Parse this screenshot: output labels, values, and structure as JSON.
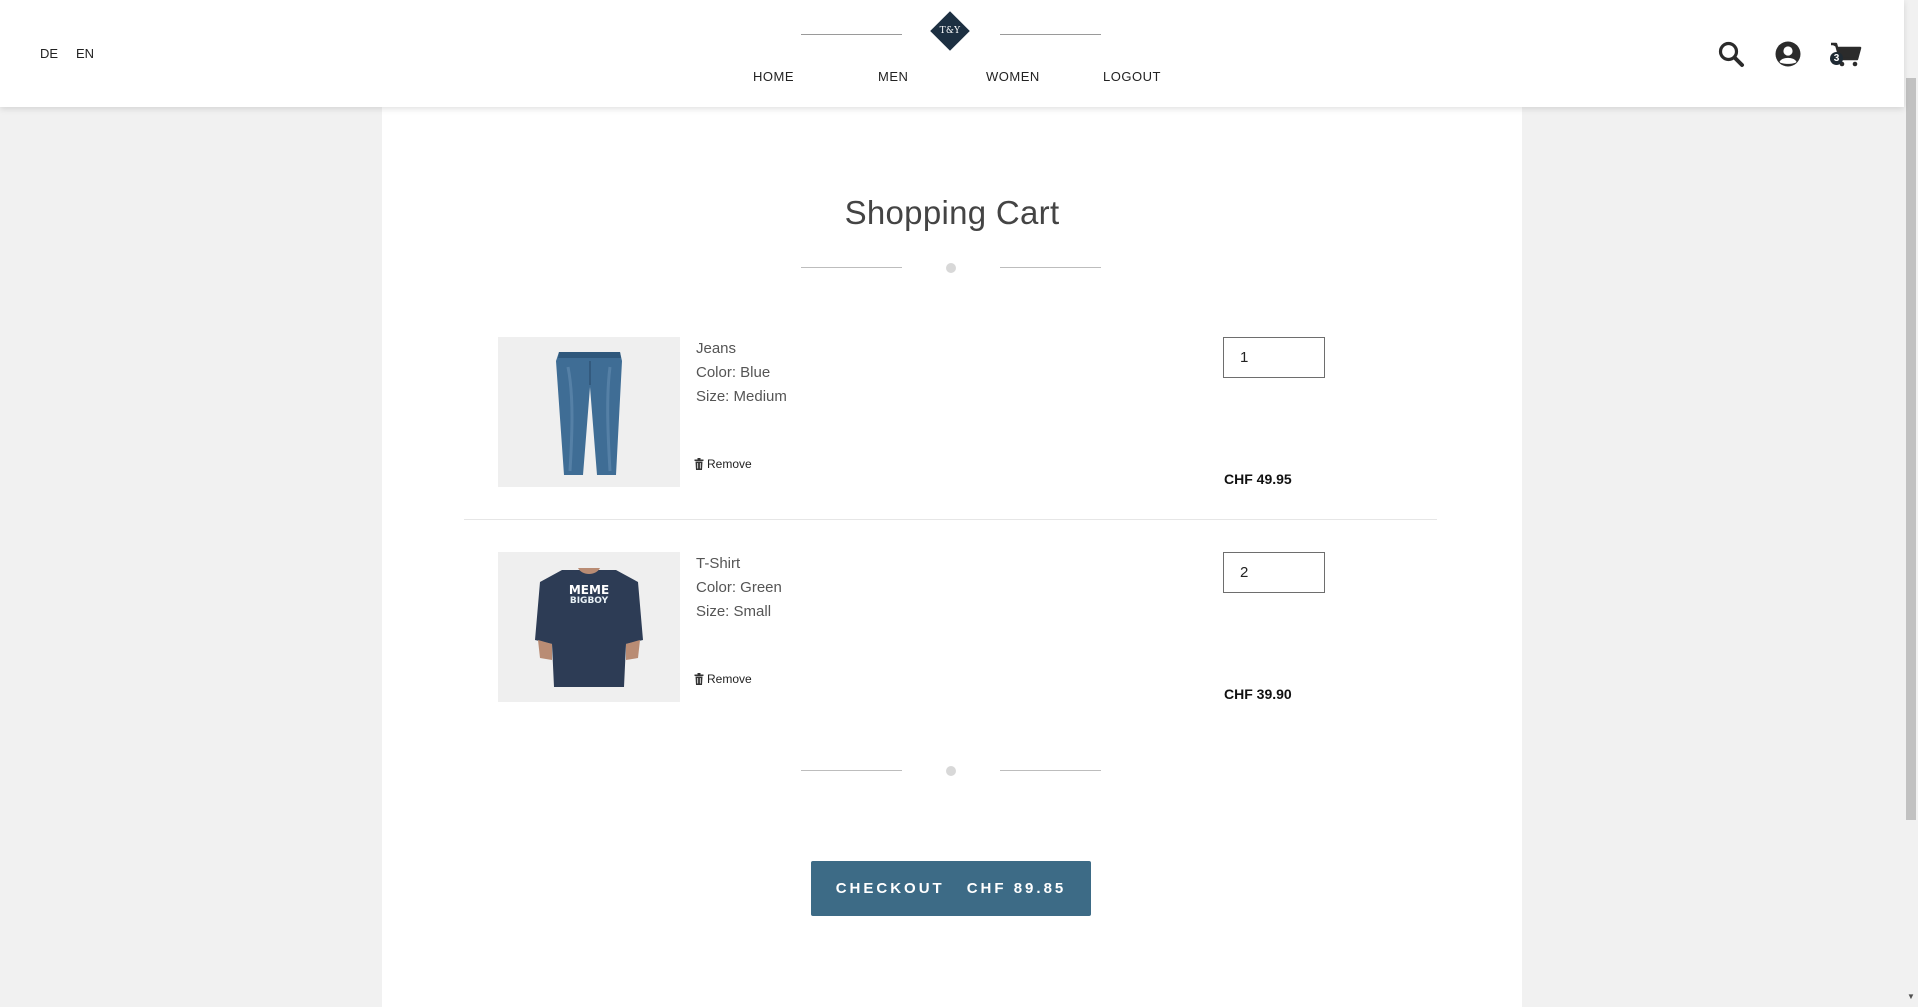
{
  "header": {
    "languages": [
      "DE",
      "EN"
    ],
    "logo_text": "T&Y",
    "nav": [
      "HOME",
      "MEN",
      "WOMEN",
      "LOGOUT"
    ],
    "cart_count": "3",
    "icons": [
      "search-icon",
      "user-icon",
      "cart-icon"
    ]
  },
  "cart": {
    "title": "Shopping Cart",
    "items": [
      {
        "name": "Jeans",
        "color": "Color: Blue",
        "size": "Size: Medium",
        "remove_label": "Remove",
        "quantity": "1",
        "price": "CHF 49.95"
      },
      {
        "name": "T-Shirt",
        "color": "Color: Green",
        "size": "Size: Small",
        "remove_label": "Remove",
        "quantity": "2",
        "price": "CHF 39.90",
        "shirt_print": [
          "MEME",
          "BIGBOY"
        ]
      }
    ],
    "checkout_label": "CHECKOUT",
    "checkout_total": "CHF 89.85"
  },
  "colors": {
    "accent": "#3d6b86",
    "logo": "#1d3042",
    "denim": "#3f6d95",
    "shirt": "#2d3c55"
  }
}
